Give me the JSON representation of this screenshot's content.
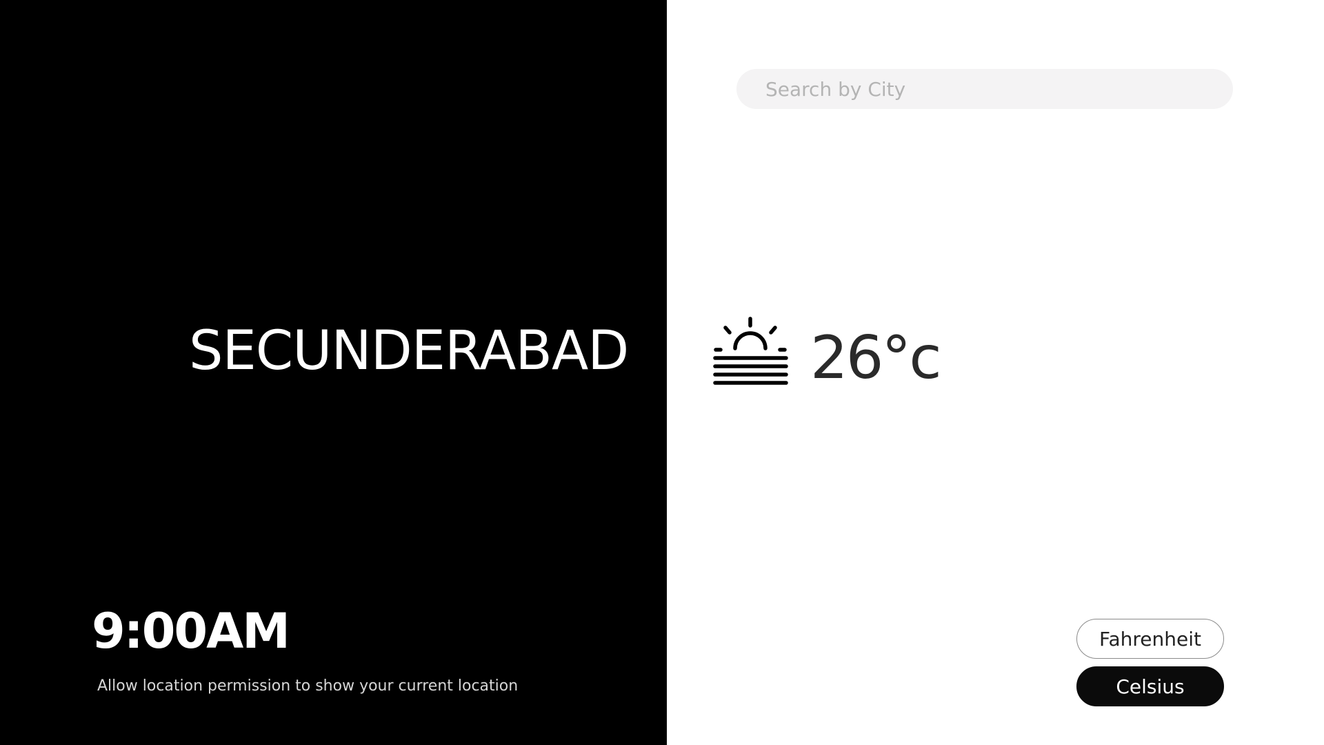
{
  "location": {
    "city": "SECUNDERABAD",
    "time": "9:00AM",
    "permission_note": "Allow location permission to show your current location"
  },
  "search": {
    "placeholder": "Search by City",
    "value": ""
  },
  "weather": {
    "icon": "sunrise-icon",
    "temperature": "26°c"
  },
  "units": {
    "fahrenheit_label": "Fahrenheit",
    "celsius_label": "Celsius",
    "selected": "Celsius"
  },
  "colors": {
    "panel_background": "#000000",
    "page_background": "#ffffff",
    "search_background": "#f4f3f4",
    "active_button": "#0b0b0b"
  }
}
